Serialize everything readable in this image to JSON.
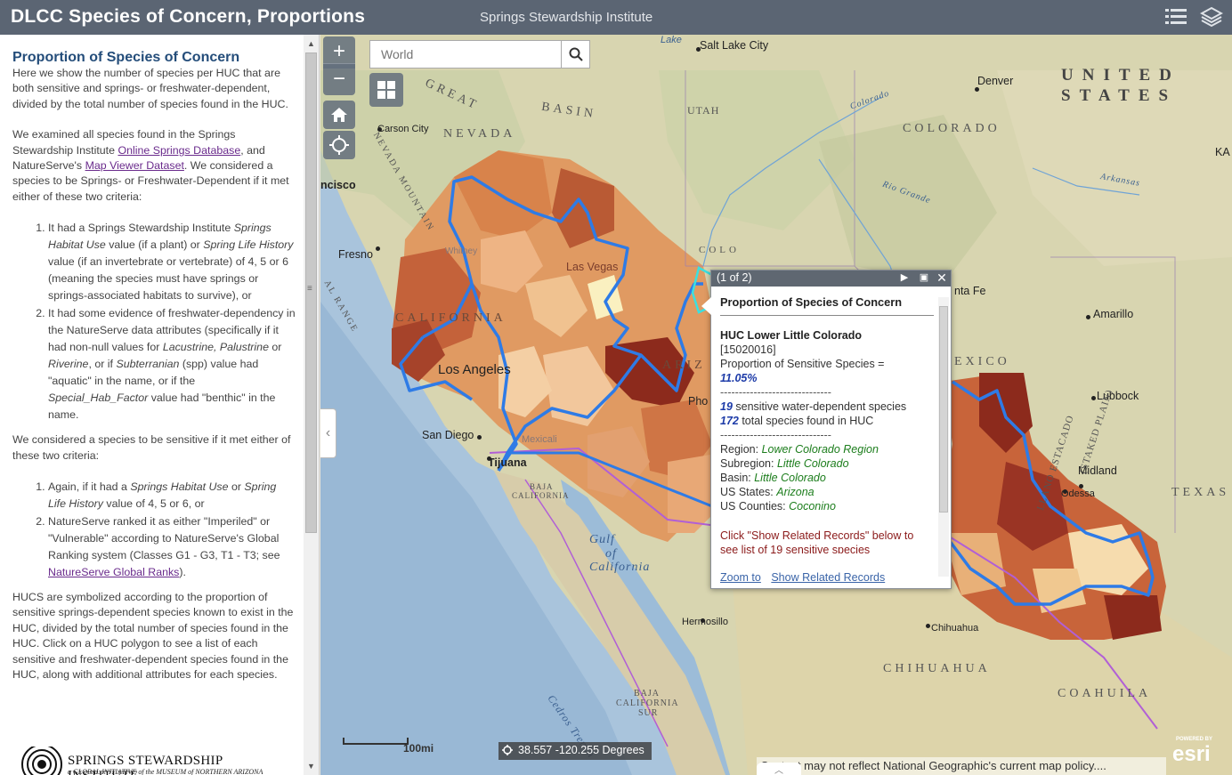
{
  "header": {
    "title": "DLCC Species of Concern, Proportions",
    "subtitle": "Springs Stewardship Institute"
  },
  "sidebar": {
    "heading": "Proportion of Species of Concern",
    "intro": "Here we show the number of species per HUC that are both sensitive and springs- or freshwater-dependent, divided by the total number of species found in the HUC.",
    "p2_a": "We examined all species found in the Springs Stewardship Institute ",
    "p2_link1": "Online Springs Database",
    "p2_b": ", and NatureServe's ",
    "p2_link2": "Map Viewer Dataset",
    "p2_c": ".  We considered a species to be Springs- or Freshwater-Dependent if it met either of these two criteria:",
    "crit1_a": "It had a Springs Stewardship Institute ",
    "crit1_i1": "Springs Habitat Use",
    "crit1_b": " value (if a plant) or ",
    "crit1_i2": "Spring Life History",
    "crit1_c": " value (if an invertebrate or vertebrate) of 4, 5 or 6 (meaning the species must have springs or springs-associated habitats to survive), or",
    "crit2_a": "It had some evidence of freshwater-dependency in the NatureServe data attributes (specifically if it had non-null values for ",
    "crit2_i1": "Lacustrine, Palustrine",
    "crit2_b": " or ",
    "crit2_i2": "Riverine",
    "crit2_c": ", or if ",
    "crit2_i3": "Subterranian",
    "crit2_d": " (spp) value had \"aquatic\" in the name, or if the ",
    "crit2_i4": "Special_Hab_Factor",
    "crit2_e": " value had \"benthic\" in the name.",
    "p3": "We considered a species to be sensitive if it met either of these two criteria:",
    "sens1_a": "Again, if it had a ",
    "sens1_i1": "Springs Habitat Use",
    "sens1_b": " or ",
    "sens1_i2": "Spring Life History",
    "sens1_c": " value of 4, 5 or 6, or",
    "sens2_a": "NatureServe ranked it as either \"Imperiled\" or \"Vulnerable\" according to NatureServe's Global Ranking system (Classes G1 - G3, T1 - T3; see ",
    "sens2_link": "NatureServe Global Ranks",
    "sens2_b": ").",
    "p4": "HUCS are symbolized according to the proportion of sensitive springs-dependent species known to exist in the HUC, divided by the total number of species found in the HUC.  Click on a HUC polygon to see a list of each sensitive and freshwater-dependent species found in the HUC, along with additional attributes for each species.",
    "logo_text": "SPRINGS STEWARDSHIP INSTITUTE",
    "logo_sub": "a GLOBAL INITIATIVE of the MUSEUM of NORTHERN ARIZONA"
  },
  "map": {
    "search_placeholder": "World",
    "scale_label": "100mi",
    "coords": "38.557 -120.255 Degrees",
    "attribution": "Content may not reflect National Geographic's current map policy....",
    "esri_powered": "POWERED BY",
    "esri_logo": "esri",
    "labels": {
      "salt_lake": "Salt Lake City",
      "lake": "Lake",
      "denver": "Denver",
      "united": "UNITED",
      "states": "STATES",
      "great": "GREAT",
      "basin": "BASIN",
      "utah": "UTAH",
      "colorado_state": "COLORADO",
      "colorado_river": "Colorado",
      "carson": "Carson City",
      "nevada": "NEVADA",
      "francisco": "ncisco",
      "ka": "KA",
      "arkansas": "Arkansas",
      "rio_grande": "Rio Grande",
      "fresno": "Fresno",
      "whitney": "Whitney",
      "lasvegas": "Las Vegas",
      "colo": "COLO",
      "santafe": "nta Fe",
      "amarillo": "Amarillo",
      "california": "CALIFORNIA",
      "losangeles": "Los Angeles",
      "ariz": "ARIZ",
      "phoenix": "Pho",
      "mexico_label": "EXICO",
      "lubbock": "Lubbock",
      "staked": "(STAKED PLAIN)",
      "llano": "LLANO ESTACADO",
      "sandiego": "San Diego",
      "tijuana": "Tijuana",
      "mexicali": "Mexicali",
      "baja_ca": "BAJA",
      "california2": "CALIFORNIA",
      "midland": "Midland",
      "odessa": "Odessa",
      "texas": "TEXAS",
      "gulf1": "Gulf",
      "gulf2": "of",
      "gulf3": "California",
      "hermosillo": "Hermosillo",
      "chihuahua": "Chihuahua",
      "chihuahua_state": "CHIHUAHUA",
      "coahuila": "COAHUILA",
      "baja_sur1": "BAJA",
      "baja_sur2": "CALIFORNIA",
      "baja_sur3": "SUR",
      "cedros": "Cedros Trench",
      "mountain": "NEVADA MOUNTAIN",
      "range": "AL RANGE"
    }
  },
  "popup": {
    "counter": "(1 of 2)",
    "title": "Proportion of Species of Concern",
    "huc_name": "HUC Lower Little Colorado",
    "huc_code": "[15020016]",
    "prop_label": "Proportion of Sensitive Species =",
    "prop_value": "11.05%",
    "separator": "------------------------------",
    "sens_count": "19",
    "sens_text": " sensitive water-dependent species",
    "total_count": "172",
    "total_text": " total species found in HUC",
    "region_label": "Region: ",
    "region_value": "Lower Colorado Region",
    "subregion_label": "Subregion: ",
    "subregion_value": "Little Colorado",
    "basin_label": "Basin: ",
    "basin_value": "Little Colorado",
    "states_label": "US States: ",
    "states_value": "Arizona",
    "counties_label": "US Counties: ",
    "counties_value": "Coconino",
    "note": "Click \"Show Related Records\" below to see list of 19 sensitive species",
    "zoom_link": "Zoom to",
    "related_link": "Show Related Records"
  },
  "colors": {
    "header_bg": "#5b6573",
    "huc_dark": "#8c1d14",
    "huc_mid": "#c8602e",
    "huc_light": "#eab383",
    "boundary": "#2e7be6"
  }
}
